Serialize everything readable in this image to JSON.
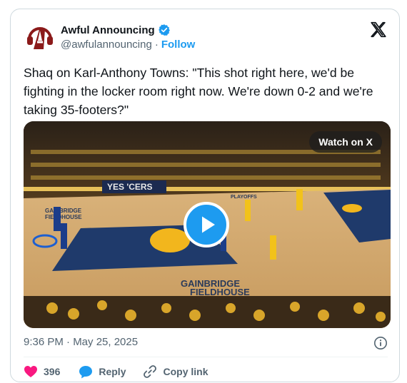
{
  "account": {
    "name": "Awful Announcing",
    "handle": "@awfulannouncing",
    "separator": "·",
    "follow_label": "Follow"
  },
  "tweet": {
    "text": "Shaq on Karl-Anthony Towns: \"This shot right here, we'd be fighting in the locker room right now. We're down 0-2 and we're taking 35-footers?\"",
    "timestamp": "9:36 PM · May 25, 2025"
  },
  "media": {
    "watch_label": "Watch on X",
    "court_text_1": "YES 'CERS",
    "court_text_2": "GAINBRIDGE",
    "court_text_3": "FIELDHOUSE",
    "court_text_4": "GAINBRIDGE",
    "court_text_5": "FIELDHOUSE",
    "court_text_6": "PLAYOFFS"
  },
  "actions": {
    "like_count": "396",
    "reply_label": "Reply",
    "copy_label": "Copy link"
  },
  "colors": {
    "accent": "#1d9bf0",
    "like": "#f91880",
    "text_secondary": "#536471",
    "brand_red": "#8b1a1a"
  }
}
